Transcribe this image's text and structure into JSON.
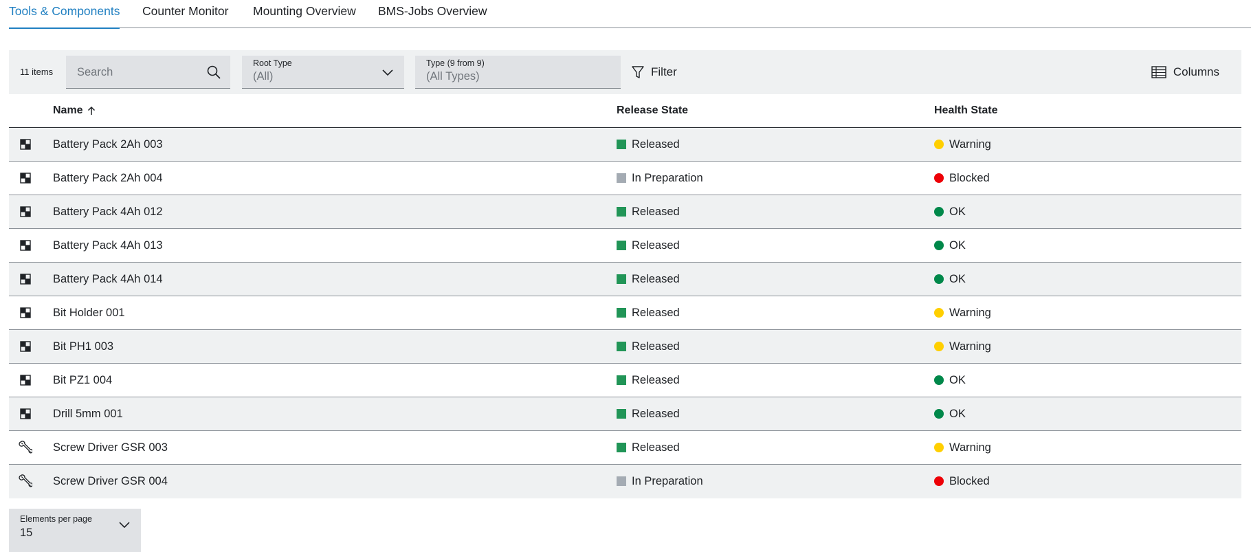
{
  "tabs": [
    {
      "label": "Tools & Components",
      "active": true
    },
    {
      "label": "Counter Monitor",
      "active": false
    },
    {
      "label": "Mounting Overview",
      "active": false
    },
    {
      "label": "BMS-Jobs Overview",
      "active": false
    }
  ],
  "toolbar": {
    "item_count": "11 items",
    "search_placeholder": "Search",
    "root_type_label": "Root Type",
    "root_type_value": "(All)",
    "type_label": "Type (9 from 9)",
    "type_value": "(All Types)",
    "filter_label": "Filter",
    "columns_label": "Columns"
  },
  "table": {
    "columns": [
      "Name",
      "Release State",
      "Health State"
    ],
    "sort_icon": "arrow-up-icon",
    "rows": [
      {
        "icon": "component-icon",
        "name": "Battery Pack 2Ah 003",
        "release": "Released",
        "health": "Warning"
      },
      {
        "icon": "component-icon",
        "name": "Battery Pack 2Ah 004",
        "release": "In Preparation",
        "health": "Blocked"
      },
      {
        "icon": "component-icon",
        "name": "Battery Pack 4Ah 012",
        "release": "Released",
        "health": "OK"
      },
      {
        "icon": "component-icon",
        "name": "Battery Pack 4Ah 013",
        "release": "Released",
        "health": "OK"
      },
      {
        "icon": "component-icon",
        "name": "Battery Pack 4Ah 014",
        "release": "Released",
        "health": "OK"
      },
      {
        "icon": "component-icon",
        "name": "Bit Holder 001",
        "release": "Released",
        "health": "Warning"
      },
      {
        "icon": "component-icon",
        "name": "Bit PH1 003",
        "release": "Released",
        "health": "Warning"
      },
      {
        "icon": "component-icon",
        "name": "Bit PZ1 004",
        "release": "Released",
        "health": "OK"
      },
      {
        "icon": "component-icon",
        "name": "Drill 5mm 001",
        "release": "Released",
        "health": "OK"
      },
      {
        "icon": "wrench-icon",
        "name": "Screw Driver GSR 003",
        "release": "Released",
        "health": "Warning"
      },
      {
        "icon": "wrench-icon",
        "name": "Screw Driver GSR 004",
        "release": "In Preparation",
        "health": "Blocked"
      }
    ]
  },
  "status_colors": {
    "Released": "#219557",
    "In Preparation": "#a4abb3",
    "Warning": "#ffcf00",
    "Blocked": "#ed0007",
    "OK": "#00884a"
  },
  "accent_color": "#1f7fc1",
  "pager": {
    "label": "Elements per page",
    "value": "15"
  }
}
